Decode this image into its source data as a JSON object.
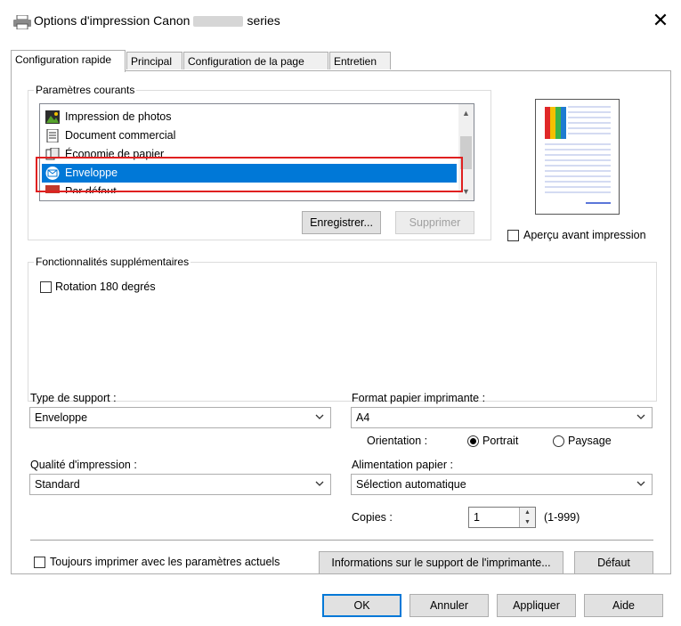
{
  "window": {
    "title_prefix": "Options d'impression Canon",
    "title_suffix": "series",
    "close_glyph": "✕"
  },
  "tabs": [
    {
      "label": "Configuration rapide",
      "active": true
    },
    {
      "label": "Principal",
      "active": false
    },
    {
      "label": "Configuration de la page",
      "active": false
    },
    {
      "label": "Entretien",
      "active": false
    }
  ],
  "current_settings": {
    "legend": "Paramètres courants",
    "items": [
      {
        "label": "Impression de photos",
        "icon": "photo-icon"
      },
      {
        "label": "Document commercial",
        "icon": "document-icon"
      },
      {
        "label": "Économie de papier",
        "icon": "paper-saving-icon"
      },
      {
        "label": "Enveloppe",
        "icon": "envelope-icon",
        "selected": true
      },
      {
        "label": "Par défaut",
        "icon": "default-icon"
      }
    ],
    "save_button": "Enregistrer...",
    "delete_button": "Supprimer",
    "preview_checkbox": "Aperçu avant impression"
  },
  "additional_features": {
    "legend": "Fonctionnalités supplémentaires",
    "rotate_checkbox": "Rotation 180 degrés"
  },
  "media": {
    "label": "Type de support :",
    "value": "Enveloppe"
  },
  "paper_size": {
    "label": "Format papier imprimante :",
    "value": "A4"
  },
  "orientation": {
    "label": "Orientation :",
    "portrait": "Portrait",
    "landscape": "Paysage",
    "selected": "Portrait"
  },
  "quality": {
    "label": "Qualité d'impression :",
    "value": "Standard"
  },
  "paper_source": {
    "label": "Alimentation papier :",
    "value": "Sélection automatique"
  },
  "copies": {
    "label": "Copies :",
    "value": "1",
    "range": "(1-999)"
  },
  "always_print_checkbox": "Toujours imprimer avec les paramètres actuels",
  "media_info_button": "Informations sur le support de l'imprimante...",
  "defaults_button": "Défaut",
  "footer": {
    "ok": "OK",
    "cancel": "Annuler",
    "apply": "Appliquer",
    "help": "Aide"
  },
  "colors": {
    "selection": "#0078d7",
    "highlight_box": "#e02020"
  }
}
